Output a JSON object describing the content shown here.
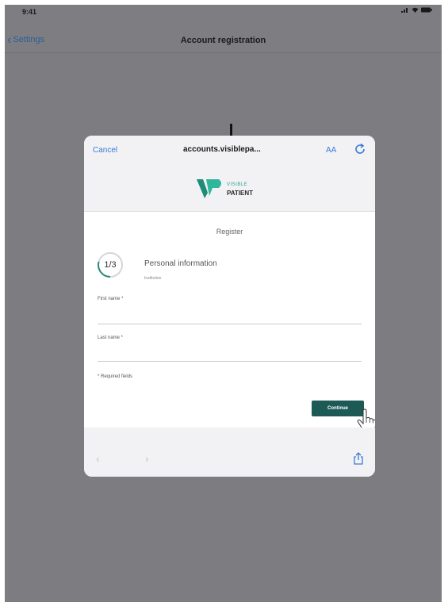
{
  "status_bar": {
    "time": "9:41"
  },
  "nav": {
    "back_label": "Settings",
    "title": "Account registration"
  },
  "browser": {
    "cancel_label": "Cancel",
    "url": "accounts.visiblepa...",
    "text_size_label": "AA"
  },
  "logo": {
    "line1": "VISIBLE",
    "line2": "PATIENT",
    "color_accent": "#27a38b"
  },
  "form": {
    "title": "Register",
    "step_label": "1/3",
    "step_title": "Personal information",
    "step_subtitle": "Institution",
    "first_name_label": "First name *",
    "first_name_value": "",
    "last_name_label": "Last name *",
    "last_name_value": "",
    "required_note": "* Required fields",
    "continue_label": "Continue",
    "continue_color": "#1d5a56"
  },
  "icons": {
    "back": "chevron-left-icon",
    "reload": "reload-icon",
    "share": "share-icon",
    "pointer": "hand-pointer-icon"
  }
}
